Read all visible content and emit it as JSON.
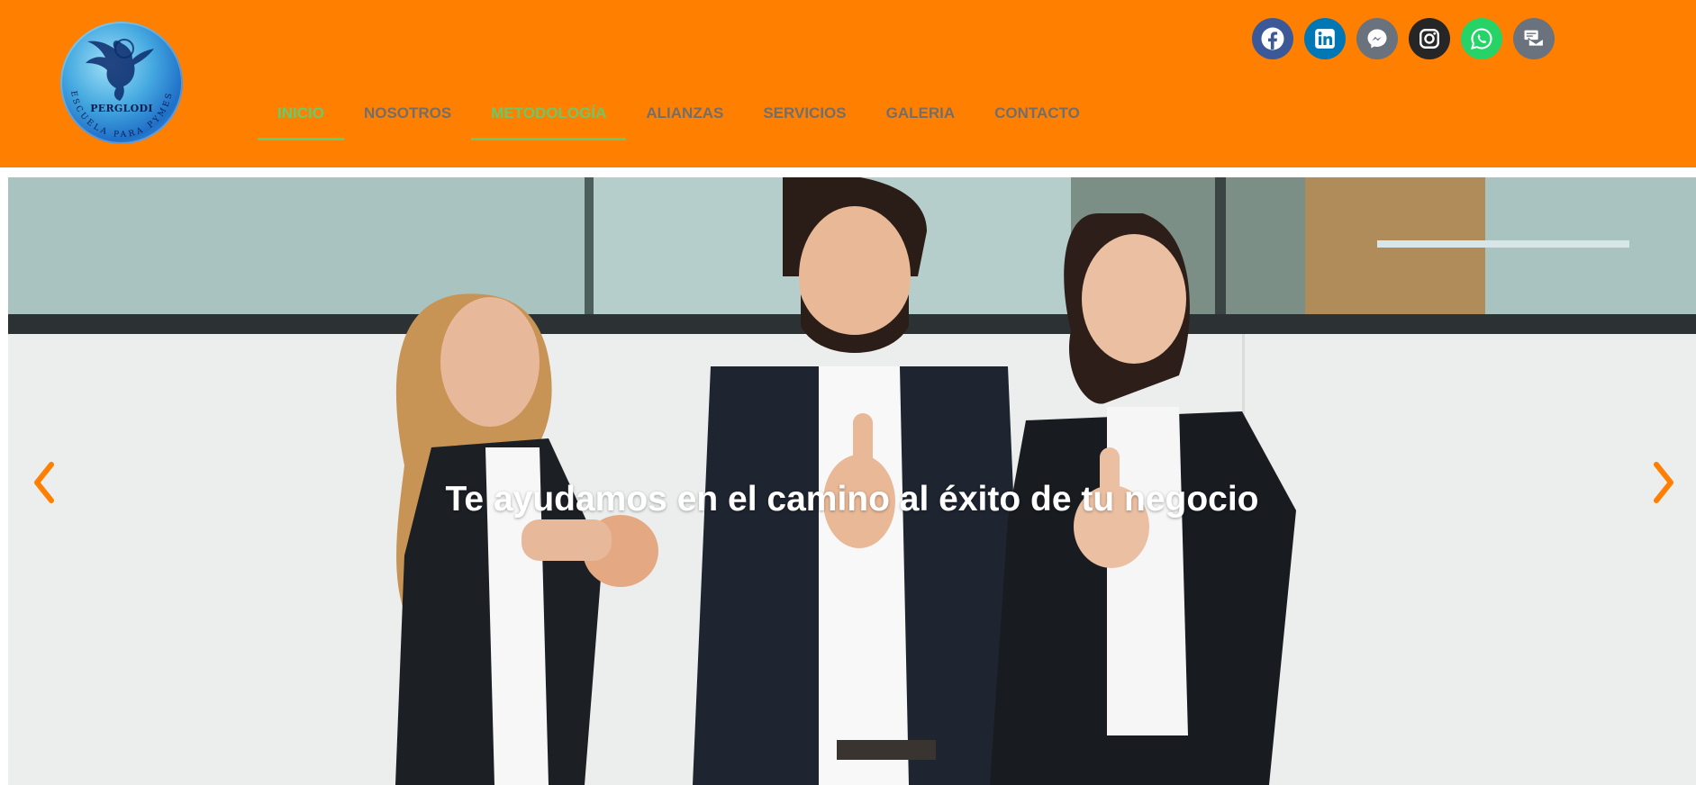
{
  "colors": {
    "header_bg": "#ff7f00",
    "nav_text": "#6f6f6f",
    "nav_active": "#61ce70",
    "arrow": "#ff7f00",
    "hero_text": "#ffffff"
  },
  "logo": {
    "name": "PERGLODI",
    "tagline": "ESCUELA PARA PYMES"
  },
  "nav": {
    "items": [
      {
        "label": "INICIO",
        "state": "active"
      },
      {
        "label": "NOSOTROS",
        "state": "normal"
      },
      {
        "label": "METODOLOGÍA",
        "state": "highlighted"
      },
      {
        "label": "ALIANZAS",
        "state": "normal"
      },
      {
        "label": "SERVICIOS",
        "state": "normal"
      },
      {
        "label": "GALERIA",
        "state": "normal"
      },
      {
        "label": "CONTACTO",
        "state": "normal"
      }
    ]
  },
  "social": [
    {
      "icon": "facebook-icon",
      "color": "#3b5998"
    },
    {
      "icon": "linkedin-icon",
      "color": "#0077b5"
    },
    {
      "icon": "messenger-icon",
      "color": "#69727d"
    },
    {
      "icon": "instagram-icon",
      "color": "#262626"
    },
    {
      "icon": "whatsapp-icon",
      "color": "#25d366"
    },
    {
      "icon": "envelope-open-text-icon",
      "color": "#69727d"
    }
  ],
  "hero": {
    "title": "Te ayudamos en el camino al éxito de tu negocio",
    "prev_icon": "chevron-left-icon",
    "next_icon": "chevron-right-icon"
  }
}
